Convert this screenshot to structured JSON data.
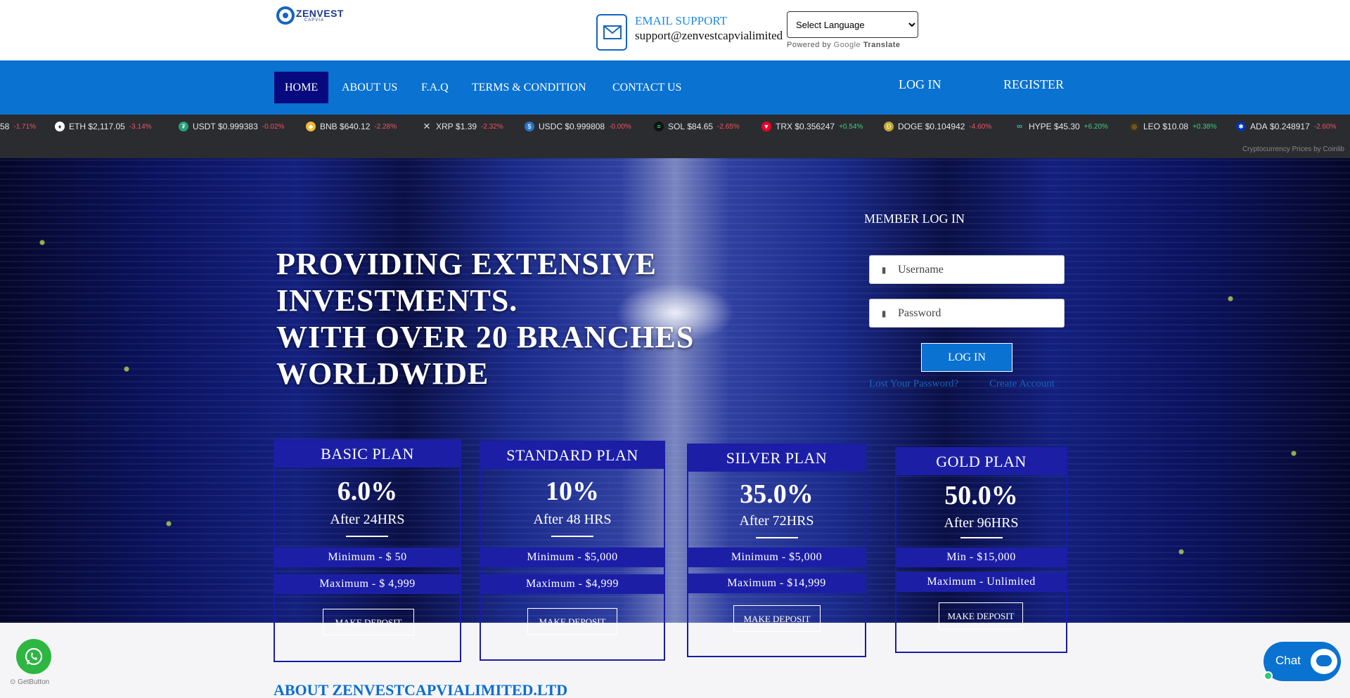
{
  "header": {
    "logo_text": "ZENVEST",
    "logo_sub": "CAPVIA",
    "email_label": "EMAIL SUPPORT",
    "email_value": "support@zenvestcapvialimited",
    "language_select": "Select Language",
    "powered_by": "Powered by",
    "google": "Google",
    "translate": "Translate"
  },
  "nav": {
    "items": [
      "HOME",
      "ABOUT US",
      "F.A.Q",
      "TERMS & CONDITION",
      "CONTACT US"
    ],
    "login": "LOG IN",
    "register": "REGISTER"
  },
  "ticker": {
    "items": [
      {
        "sym": "",
        "price": "58",
        "chg": "-1.71%",
        "dir": "neg",
        "color": "#f7931a",
        "icon": "btc-icon"
      },
      {
        "sym": "ETH",
        "price": "$2,117.05",
        "chg": "-3.14%",
        "dir": "neg",
        "color": "#627eea",
        "icon": "eth-icon"
      },
      {
        "sym": "USDT",
        "price": "$0.999383",
        "chg": "-0.02%",
        "dir": "neg",
        "color": "#26a17b",
        "icon": "usdt-icon"
      },
      {
        "sym": "BNB",
        "price": "$640.12",
        "chg": "-2.28%",
        "dir": "neg",
        "color": "#f3ba2f",
        "icon": "bnb-icon"
      },
      {
        "sym": "XRP",
        "price": "$1.39",
        "chg": "-2.32%",
        "dir": "neg",
        "color": "#23292f",
        "icon": "xrp-icon"
      },
      {
        "sym": "USDC",
        "price": "$0.999808",
        "chg": "-0.00%",
        "dir": "neg",
        "color": "#2775ca",
        "icon": "usdc-icon"
      },
      {
        "sym": "SOL",
        "price": "$84.65",
        "chg": "-2.65%",
        "dir": "neg",
        "color": "#14f195",
        "icon": "sol-icon"
      },
      {
        "sym": "TRX",
        "price": "$0.356247",
        "chg": "+0.54%",
        "dir": "pos",
        "color": "#ef0027",
        "icon": "trx-icon"
      },
      {
        "sym": "DOGE",
        "price": "$0.104942",
        "chg": "-4.60%",
        "dir": "neg",
        "color": "#c2a633",
        "icon": "doge-icon"
      },
      {
        "sym": "HYPE",
        "price": "$45.30",
        "chg": "+6.20%",
        "dir": "pos",
        "color": "#50e3c2",
        "icon": "hype-icon"
      },
      {
        "sym": "LEO",
        "price": "$10.08",
        "chg": "+0.38%",
        "dir": "pos",
        "color": "#8a6d1e",
        "icon": "leo-icon"
      },
      {
        "sym": "ADA",
        "price": "$0.248917",
        "chg": "-2.60%",
        "dir": "neg",
        "color": "#0033ad",
        "icon": "ada-icon"
      }
    ],
    "credit": "Cryptocurrency Prices by Coinlib"
  },
  "hero": {
    "headline_1": "PROVIDING EXTENSIVE",
    "headline_2": "INVESTMENTS.",
    "headline_3": "WITH OVER 20 BRANCHES",
    "headline_4": "WORLDWIDE"
  },
  "login": {
    "title": "MEMBER LOG IN",
    "username_placeholder": "Username",
    "password_placeholder": "Password",
    "button": "LOG IN",
    "forgot": "Lost Your Password?",
    "create": "Create Account"
  },
  "plans": [
    {
      "name": "BASIC PLAN",
      "rate": "6.0%",
      "after": "After 24HRS",
      "min": "Minimum - $ 50",
      "max": "Maximum - $ 4,999",
      "button": "MAKE DEPOSIT"
    },
    {
      "name": "STANDARD PLAN",
      "rate": "10%",
      "after": "After 48 HRS",
      "min": "Minimum - $5,000",
      "max": "Maximum - $4,999",
      "button": "MAKE DEPOSIT"
    },
    {
      "name": "SILVER PLAN",
      "rate": "35.0%",
      "after": "After 72HRS",
      "min": "Minimum - $5,000",
      "max": "Maximum - $14,999",
      "button": "MAKE DEPOSIT"
    },
    {
      "name": "GOLD PLAN",
      "rate": "50.0%",
      "after": "After 96HRS",
      "min": "Min - $15,000",
      "max": "Maximum - Unlimited",
      "button": "MAKE DEPOSIT"
    }
  ],
  "floating": {
    "getbutton": "GetButton",
    "chat": "Chat"
  },
  "about": {
    "heading": "ABOUT ZENVESTCAPVIALIMITED.LTD"
  }
}
